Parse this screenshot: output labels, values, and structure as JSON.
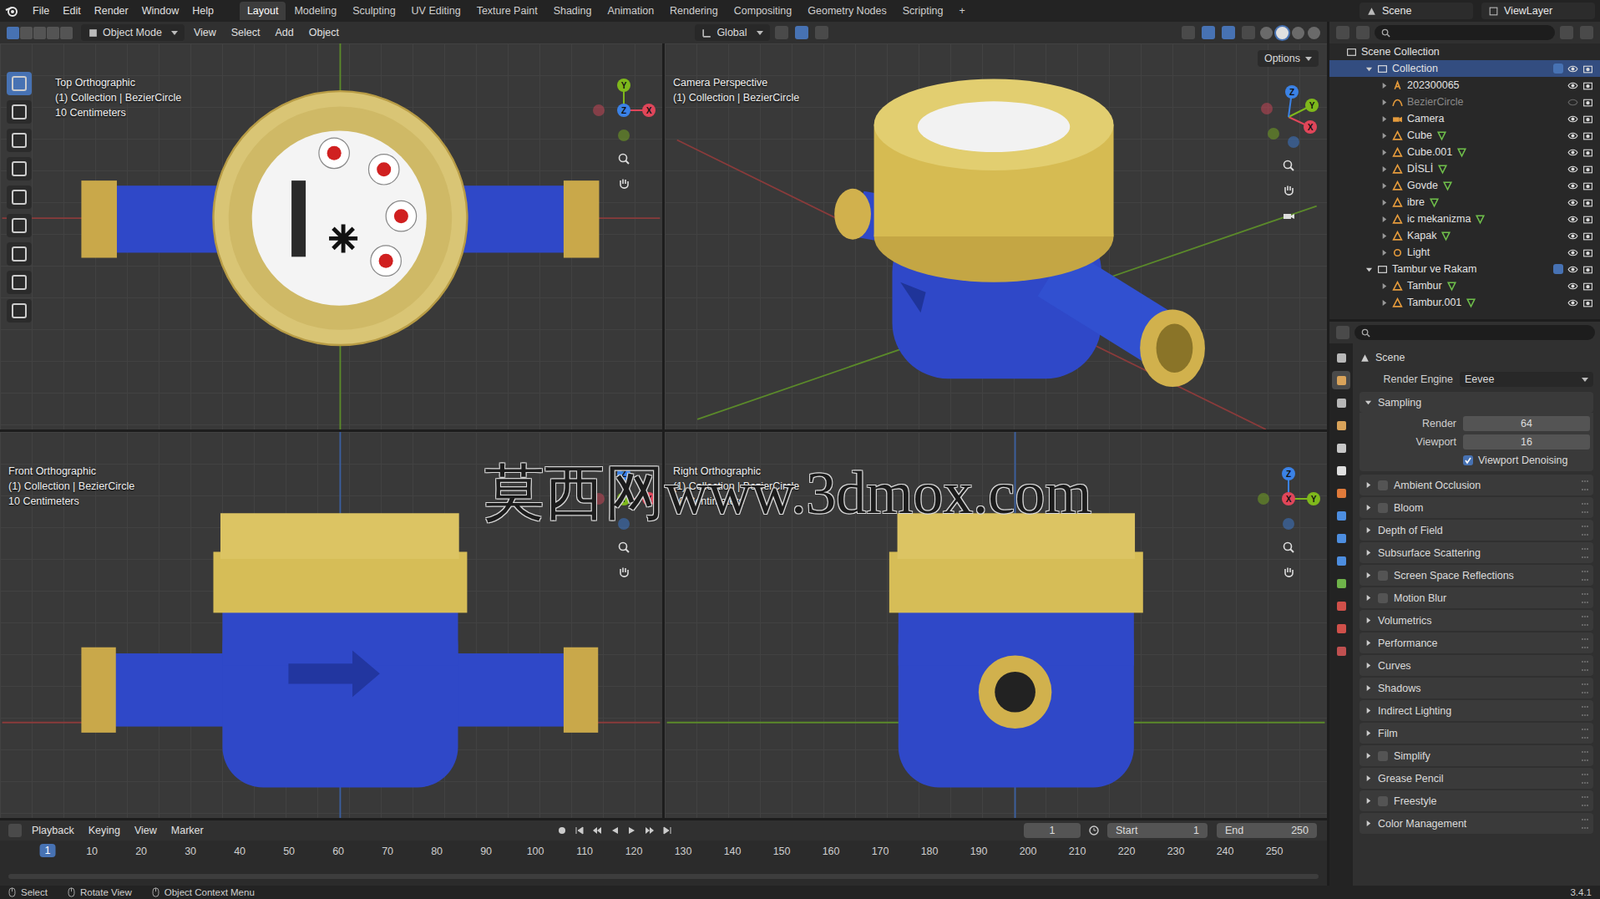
{
  "window": {
    "title": "Blender",
    "version": "3.4.1"
  },
  "menu": [
    "File",
    "Edit",
    "Render",
    "Window",
    "Help"
  ],
  "workspaces": [
    {
      "label": "Layout",
      "selected": true
    },
    {
      "label": "Modeling",
      "selected": false
    },
    {
      "label": "Sculpting",
      "selected": false
    },
    {
      "label": "UV Editing",
      "selected": false
    },
    {
      "label": "Texture Paint",
      "selected": false
    },
    {
      "label": "Shading",
      "selected": false
    },
    {
      "label": "Animation",
      "selected": false
    },
    {
      "label": "Rendering",
      "selected": false
    },
    {
      "label": "Compositing",
      "selected": false
    },
    {
      "label": "Geometry Nodes",
      "selected": false
    },
    {
      "label": "Scripting",
      "selected": false
    }
  ],
  "add_workspace": "+",
  "scene": "Scene",
  "view_layer": "ViewLayer",
  "viewport_header": {
    "mode": "Object Mode",
    "menus": [
      "View",
      "Select",
      "Add",
      "Object"
    ],
    "orientation": "Global",
    "options": "Options",
    "select_modes": [
      {
        "selected": true
      },
      {
        "selected": false
      },
      {
        "selected": false
      },
      {
        "selected": false
      },
      {
        "selected": false
      }
    ],
    "shading_modes": [
      {
        "selected": false
      },
      {
        "selected": true
      },
      {
        "selected": false
      },
      {
        "selected": false
      }
    ]
  },
  "tools": [
    {
      "selected": true
    },
    {
      "selected": false
    },
    {
      "selected": false
    },
    {
      "selected": false
    },
    {
      "selected": false
    },
    {
      "selected": false
    },
    {
      "selected": false
    },
    {
      "selected": false
    },
    {
      "selected": false
    }
  ],
  "axes": [
    {
      "label": "X",
      "color": "#e0465a"
    },
    {
      "label": "Y",
      "color": "#7fb81c"
    },
    {
      "label": "Z",
      "color": "#3b82e6"
    }
  ],
  "viewports": [
    {
      "kind": "top",
      "lines": [
        "Top Orthographic",
        "(1) Collection | BezierCircle",
        "10 Centimeters"
      ]
    },
    {
      "kind": "camera",
      "lines": [
        "Camera Perspective",
        "(1) Collection | BezierCircle"
      ]
    },
    {
      "kind": "front",
      "lines": [
        "Front Orthographic",
        "(1) Collection | BezierCircle",
        "10 Centimeters"
      ]
    },
    {
      "kind": "right",
      "lines": [
        "Right Orthographic",
        "(1) Collection | BezierCircle",
        "10 Centimeters"
      ]
    }
  ],
  "watermark": "莫西网www.3dmox.com",
  "outliner": {
    "root": "Scene Collection",
    "items": [
      {
        "name": "Collection",
        "kind": "collection",
        "depth": 1,
        "expanded": true,
        "hidden": false,
        "selected": true
      },
      {
        "name": "202300065",
        "kind": "text",
        "depth": 2,
        "expanded": false,
        "hidden": false,
        "selected": false
      },
      {
        "name": "BezierCircle",
        "kind": "curve",
        "depth": 2,
        "expanded": false,
        "hidden": true,
        "selected": false
      },
      {
        "name": "Camera",
        "kind": "camera",
        "depth": 2,
        "expanded": false,
        "hidden": false,
        "selected": false
      },
      {
        "name": "Cube",
        "kind": "mesh",
        "depth": 2,
        "expanded": false,
        "hidden": false,
        "selected": false
      },
      {
        "name": "Cube.001",
        "kind": "mesh",
        "depth": 2,
        "expanded": false,
        "hidden": false,
        "selected": false
      },
      {
        "name": "DİSLİ",
        "kind": "mesh",
        "depth": 2,
        "expanded": false,
        "hidden": false,
        "selected": false
      },
      {
        "name": "Govde",
        "kind": "mesh",
        "depth": 2,
        "expanded": false,
        "hidden": false,
        "selected": false
      },
      {
        "name": "ibre",
        "kind": "mesh",
        "depth": 2,
        "expanded": false,
        "hidden": false,
        "selected": false
      },
      {
        "name": "ic mekanizma",
        "kind": "mesh",
        "depth": 2,
        "expanded": false,
        "hidden": false,
        "selected": false
      },
      {
        "name": "Kapak",
        "kind": "mesh",
        "depth": 2,
        "expanded": false,
        "hidden": false,
        "selected": false
      },
      {
        "name": "Light",
        "kind": "light",
        "depth": 2,
        "expanded": false,
        "hidden": false,
        "selected": false
      },
      {
        "name": "Tambur ve Rakam",
        "kind": "collection",
        "depth": 1,
        "expanded": true,
        "hidden": false,
        "selected": false
      },
      {
        "name": "Tambur",
        "kind": "mesh",
        "depth": 2,
        "expanded": false,
        "hidden": false,
        "selected": false
      },
      {
        "name": "Tambur.001",
        "kind": "mesh",
        "depth": 2,
        "expanded": false,
        "hidden": false,
        "selected": false
      }
    ]
  },
  "property_tabs": [
    {
      "selected": false
    },
    {
      "selected": true
    },
    {
      "selected": false
    },
    {
      "selected": false
    },
    {
      "selected": false
    },
    {
      "selected": false
    },
    {
      "selected": false
    },
    {
      "selected": false
    },
    {
      "selected": false
    },
    {
      "selected": false
    },
    {
      "selected": false
    },
    {
      "selected": false
    },
    {
      "selected": false
    },
    {
      "selected": false
    }
  ],
  "properties": {
    "title": "Scene",
    "engine_label": "Render Engine",
    "engine": "Eevee",
    "sampling": {
      "label": "Sampling",
      "expanded": true,
      "fields": [
        {
          "label": "Render",
          "value": "64"
        },
        {
          "label": "Viewport",
          "value": "16"
        }
      ],
      "denoise": {
        "label": "Viewport Denoising",
        "checked": true
      }
    },
    "panels": [
      {
        "label": "Ambient Occlusion",
        "has_checkbox": true,
        "checked": false
      },
      {
        "label": "Bloom",
        "has_checkbox": true,
        "checked": false
      },
      {
        "label": "Depth of Field",
        "has_checkbox": false,
        "checked": false
      },
      {
        "label": "Subsurface Scattering",
        "has_checkbox": false,
        "checked": false
      },
      {
        "label": "Screen Space Reflections",
        "has_checkbox": true,
        "checked": false
      },
      {
        "label": "Motion Blur",
        "has_checkbox": true,
        "checked": false
      },
      {
        "label": "Volumetrics",
        "has_checkbox": false,
        "checked": false
      },
      {
        "label": "Performance",
        "has_checkbox": false,
        "checked": false
      },
      {
        "label": "Curves",
        "has_checkbox": false,
        "checked": false
      },
      {
        "label": "Shadows",
        "has_checkbox": false,
        "checked": false
      },
      {
        "label": "Indirect Lighting",
        "has_checkbox": false,
        "checked": false
      },
      {
        "label": "Film",
        "has_checkbox": false,
        "checked": false
      },
      {
        "label": "Simplify",
        "has_checkbox": true,
        "checked": false
      },
      {
        "label": "Grease Pencil",
        "has_checkbox": false,
        "checked": false
      },
      {
        "label": "Freestyle",
        "has_checkbox": true,
        "checked": false
      },
      {
        "label": "Color Management",
        "has_checkbox": false,
        "checked": false
      }
    ]
  },
  "timeline": {
    "menus": [
      "Playback",
      "Keying",
      "View",
      "Marker"
    ],
    "current_frame": "1",
    "start_label": "Start",
    "start": "1",
    "end_label": "End",
    "end": "250",
    "ticks": [
      "10",
      "20",
      "30",
      "40",
      "50",
      "60",
      "70",
      "80",
      "90",
      "100",
      "110",
      "120",
      "130",
      "140",
      "150",
      "160",
      "170",
      "180",
      "190",
      "200",
      "210",
      "220",
      "230",
      "240",
      "250"
    ]
  },
  "status": [
    "Select",
    "Rotate View",
    "Object Context Menu"
  ]
}
